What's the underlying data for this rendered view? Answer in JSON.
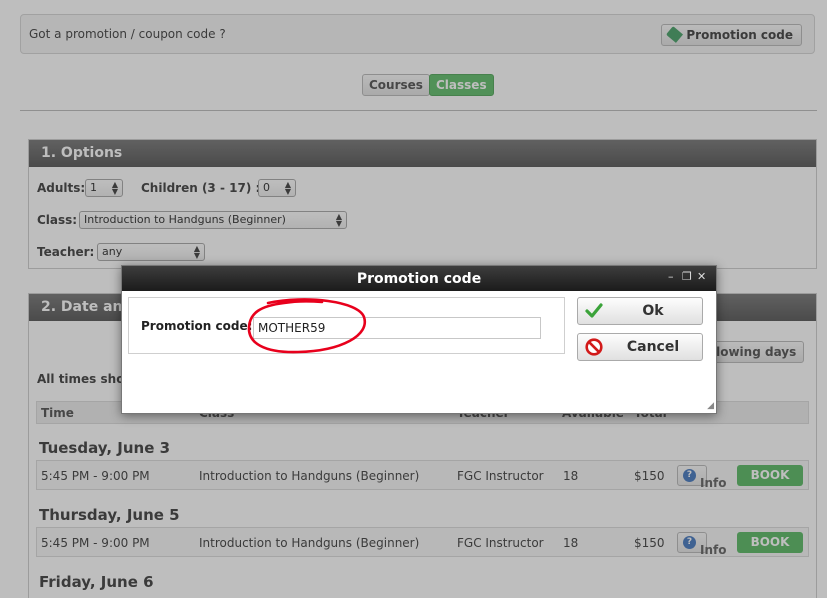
{
  "promo_bar": {
    "question": "Got a promotion / coupon code ?",
    "button_label": "Promotion code"
  },
  "switcher": {
    "courses": "Courses",
    "classes": "Classes"
  },
  "options": {
    "heading": "1. Options",
    "adults_label": "Adults:",
    "adults_value": "1",
    "children_label": "Children (3 - 17) :",
    "children_value": "0",
    "class_label": "Class:",
    "class_value": "Introduction to Handguns (Beginner)",
    "teacher_label": "Teacher:",
    "teacher_value": "any"
  },
  "date_section": {
    "heading": "2. Date and",
    "note": "All times show",
    "following_button": "llowing days",
    "columns": [
      "Time",
      "Class",
      "Teacher",
      "Available",
      "Total"
    ]
  },
  "schedule": [
    {
      "day": "Tuesday, June 3",
      "time": "5:45 PM - 9:00 PM",
      "class": "Introduction to Handguns (Beginner)",
      "teacher": "FGC Instructor",
      "available": "18",
      "total": "$150",
      "info": "Info",
      "book": "BOOK"
    },
    {
      "day": "Thursday, June 5",
      "time": "5:45 PM - 9:00 PM",
      "class": "Introduction to Handguns (Beginner)",
      "teacher": "FGC Instructor",
      "available": "18",
      "total": "$150",
      "info": "Info",
      "book": "BOOK"
    },
    {
      "day": "Friday, June 6"
    }
  ],
  "dialog": {
    "title": "Promotion code",
    "field_label": "Promotion code:",
    "field_value": "MOTHER59",
    "ok_label": "Ok",
    "cancel_label": "Cancel"
  },
  "colors": {
    "book_green": "#5dbb68",
    "annotation_red": "#e8001c"
  },
  "icons": [
    "tag-icon",
    "check-icon",
    "cancel-icon",
    "info-icon",
    "minimize-icon",
    "restore-icon",
    "close-icon",
    "resize-grip-icon"
  ]
}
